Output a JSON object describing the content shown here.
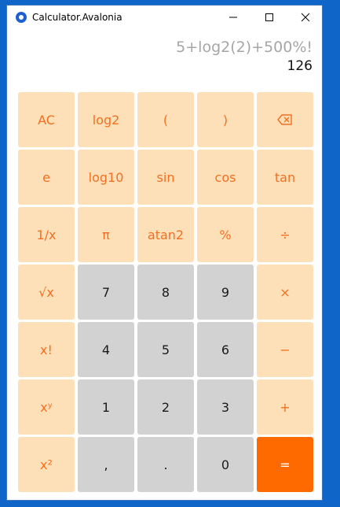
{
  "window": {
    "title": "Calculator.Avalonia"
  },
  "display": {
    "expression": "5+log2(2)+500%!",
    "result": "126"
  },
  "keys": [
    {
      "label": "AC",
      "kind": "func",
      "name": "clear-button"
    },
    {
      "label": "log2",
      "kind": "func",
      "name": "log2-button"
    },
    {
      "label": "(",
      "kind": "func",
      "name": "open-paren-button"
    },
    {
      "label": ")",
      "kind": "func",
      "name": "close-paren-button"
    },
    {
      "label": "",
      "kind": "func",
      "name": "backspace-button",
      "icon": "backspace-icon"
    },
    {
      "label": "e",
      "kind": "func",
      "name": "e-button"
    },
    {
      "label": "log10",
      "kind": "func",
      "name": "log10-button"
    },
    {
      "label": "sin",
      "kind": "func",
      "name": "sin-button"
    },
    {
      "label": "cos",
      "kind": "func",
      "name": "cos-button"
    },
    {
      "label": "tan",
      "kind": "func",
      "name": "tan-button"
    },
    {
      "label": "1/x",
      "kind": "func",
      "name": "reciprocal-button"
    },
    {
      "label": "π",
      "kind": "func",
      "name": "pi-button"
    },
    {
      "label": "atan2",
      "kind": "func",
      "name": "atan2-button"
    },
    {
      "label": "%",
      "kind": "func",
      "name": "percent-button"
    },
    {
      "label": "÷",
      "kind": "func",
      "name": "divide-button"
    },
    {
      "label": "√x",
      "kind": "func",
      "name": "sqrt-button"
    },
    {
      "label": "7",
      "kind": "digit",
      "name": "digit-7-button"
    },
    {
      "label": "8",
      "kind": "digit",
      "name": "digit-8-button"
    },
    {
      "label": "9",
      "kind": "digit",
      "name": "digit-9-button"
    },
    {
      "label": "×",
      "kind": "func",
      "name": "multiply-button"
    },
    {
      "label": "x!",
      "kind": "func",
      "name": "factorial-button"
    },
    {
      "label": "4",
      "kind": "digit",
      "name": "digit-4-button"
    },
    {
      "label": "5",
      "kind": "digit",
      "name": "digit-5-button"
    },
    {
      "label": "6",
      "kind": "digit",
      "name": "digit-6-button"
    },
    {
      "label": "−",
      "kind": "func",
      "name": "subtract-button"
    },
    {
      "label": "xʸ",
      "kind": "func",
      "name": "power-button"
    },
    {
      "label": "1",
      "kind": "digit",
      "name": "digit-1-button"
    },
    {
      "label": "2",
      "kind": "digit",
      "name": "digit-2-button"
    },
    {
      "label": "3",
      "kind": "digit",
      "name": "digit-3-button"
    },
    {
      "label": "+",
      "kind": "func",
      "name": "add-button"
    },
    {
      "label": "x²",
      "kind": "func",
      "name": "square-button"
    },
    {
      "label": ",",
      "kind": "digit",
      "name": "comma-button"
    },
    {
      "label": ".",
      "kind": "digit",
      "name": "decimal-button"
    },
    {
      "label": "0",
      "kind": "digit",
      "name": "digit-0-button"
    },
    {
      "label": "=",
      "kind": "equals",
      "name": "equals-button"
    }
  ],
  "colors": {
    "function_key": "#fde0b8",
    "function_text": "#f46f22",
    "digit_key": "#d2d2d2",
    "equals_key": "#ff6a00"
  }
}
